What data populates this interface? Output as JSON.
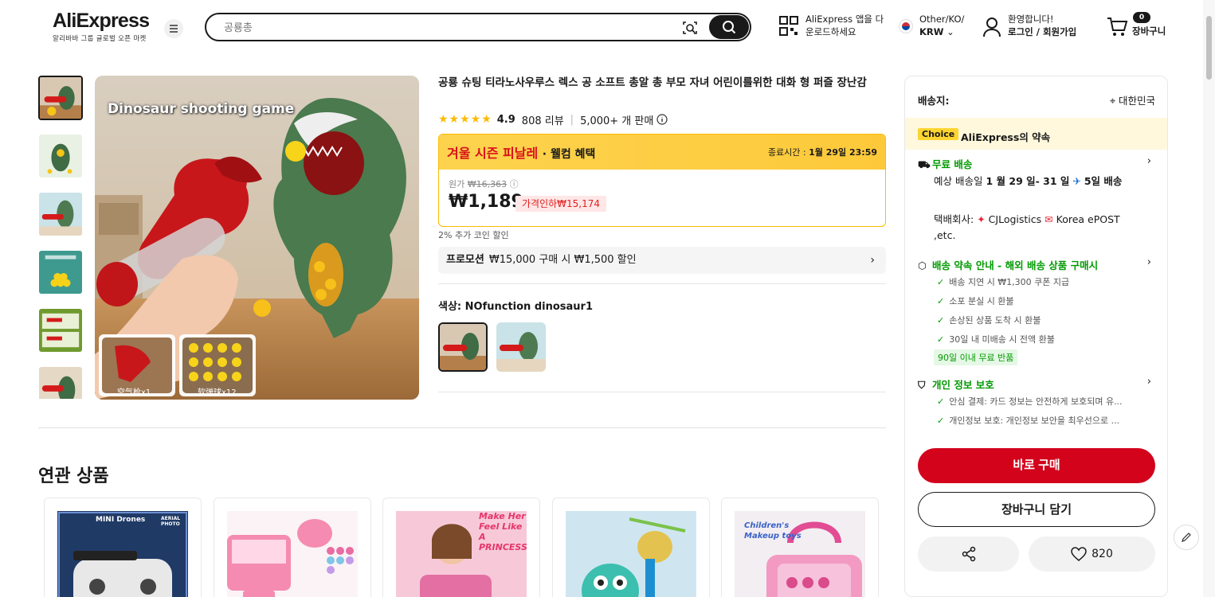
{
  "header": {
    "logo": "AliExpress",
    "logo_sub": "알리바바 그룹 글로벌 오픈 마켓",
    "search_placeholder": "공룡총",
    "app_line1": "AliExpress 앱을 다",
    "app_line2": "운로드하세요",
    "region_line1": "Other/KO/",
    "region_line2": "KRW",
    "user_line1": "환영합니다!",
    "user_line2": "로그인 / 회원가입",
    "cart_count": "0",
    "cart_label": "장바구니"
  },
  "product": {
    "title": "공룡 슈팅 티라노사우루스 렉스 공 소프트 총알 총 부모 자녀 어린이를위한 대화 형 퍼즐 장난감",
    "rating": "4.9",
    "reviews": "808 리뷰",
    "sold": "5,000+ 개 판매",
    "image_caption": "Dinosaur shooting game",
    "image_sub1": "空气枪x1",
    "image_sub2": "软弹球x12",
    "sale_title": "겨울 시즌 피날레",
    "sale_sub": "· 웰컴 혜택",
    "sale_end_label": "종료시간 :",
    "sale_end_value": "1월 29일 23:59",
    "orig_label": "원가",
    "orig_price": "₩16,363",
    "price": "₩1,189",
    "discount": "가격인하₩15,174",
    "coin_note": "2% 추가 코인 할인",
    "promo_label": "프로모션",
    "promo_text": "₩15,000 구매 시 ₩1,500 할인",
    "color_label": "색상: NOfunction dinosaur1"
  },
  "related": {
    "title": "연관 상품",
    "card1_text": "MINI Drones",
    "card1_text2": "AERIAL PHOTO",
    "card3_text": "Make Her Feel Like A PRINCESS",
    "card5_text": "Children's Makeup toys"
  },
  "panel": {
    "ship_label": "배송지:",
    "ship_dest": "대한민국",
    "choice_tag": "Choice",
    "choice_text": "AliExpress의 약속",
    "free_ship": "무료 배송",
    "delivery_text_1": "예상 배송일",
    "delivery_dates": "1 월 29 일- 31 일",
    "delivery_days": "5일 배송",
    "carrier_label": "택배회사:",
    "carrier_1": "CJLogistics",
    "carrier_2": "Korea ePOST ,etc.",
    "promise_head": "배송 약속 안내 - 해외 배송 상품 구매시",
    "promise_1": "배송 지연 시 ₩1,300 쿠폰 지급",
    "promise_2": "소포 분실 시 환불",
    "promise_3": "손상된 상품 도착 시 환불",
    "promise_4": "30일 내 미배송 시 전액 환불",
    "return_tag": "90일 이내 무료 반품",
    "privacy_head": "개인 정보 보호",
    "privacy_1": "안심 결제: 카드 정보는 안전하게 보호되며 유...",
    "privacy_2": "개인정보 보호: 개인정보 보안을 최우선으로 ...",
    "buy_now": "바로 구매",
    "add_to_cart": "장바구니 담기",
    "wish_count": "820"
  },
  "colors": {
    "accent_red": "#d3031c",
    "green": "#009a00",
    "sale_yellow": "#fdd34e"
  }
}
